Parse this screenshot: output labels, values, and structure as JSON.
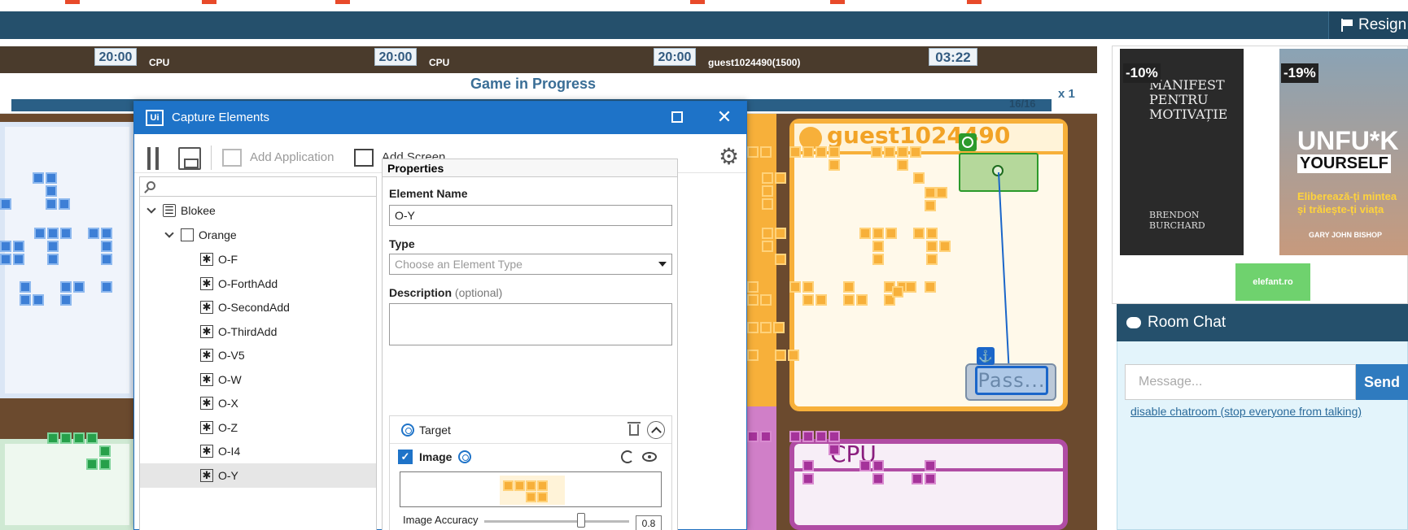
{
  "navbar": {
    "resign_label": "Resign"
  },
  "clocks": [
    {
      "time": "20:00",
      "player": "CPU"
    },
    {
      "time": "20:00",
      "player": "CPU"
    },
    {
      "time": "20:00",
      "player": "guest1024490(1500)"
    },
    {
      "time": "03:22",
      "player": ""
    }
  ],
  "game": {
    "status": "Game in Progress",
    "progress": "16/16",
    "speed": "x 1",
    "orange_player": "guest1024490",
    "purple_player": "CPU",
    "pass_label": "Pass..."
  },
  "ads": {
    "book1_discount": "-10%",
    "book1_title": "MANIFEST PENTRU MOTIVAȚIE",
    "book1_author": "BRENDON BURCHARD",
    "book2_discount": "-19%",
    "book2_title1": "UNFU*K",
    "book2_title2": "YOURSELF",
    "book2_subtitle": "Eliberează-ți mintea și trăiește-ți viața",
    "book2_author": "GARY JOHN BISHOP",
    "store": "elefant.ro"
  },
  "chat": {
    "title": "Room Chat",
    "placeholder": "Message...",
    "send_label": "Send",
    "disable_link": "disable chatroom (stop everyone from talking)"
  },
  "capture": {
    "title": "Capture Elements",
    "logo": "Ui",
    "toolbar": {
      "add_application": "Add Application",
      "add_screen": "Add Screen"
    },
    "tree": {
      "app": "Blokee",
      "group": "Orange",
      "items": [
        "O-F",
        "O-ForthAdd",
        "O-SecondAdd",
        "O-ThirdAdd",
        "O-V5",
        "O-W",
        "O-X",
        "O-Z",
        "O-I4",
        "O-Y"
      ],
      "selected": "O-Y"
    },
    "properties": {
      "header": "Properties",
      "element_name_label": "Element Name",
      "element_name_value": "O-Y",
      "type_label": "Type",
      "type_placeholder": "Choose an Element Type",
      "description_label": "Description",
      "description_optional": "(optional)",
      "target_label": "Target",
      "image_label": "Image",
      "accuracy_label": "Image Accuracy",
      "accuracy_value": "0.8"
    }
  },
  "colors": {
    "nav": "#25506c",
    "capture_blue": "#1e73c8",
    "orange": "#f7b03a",
    "purple": "#a5339a"
  }
}
